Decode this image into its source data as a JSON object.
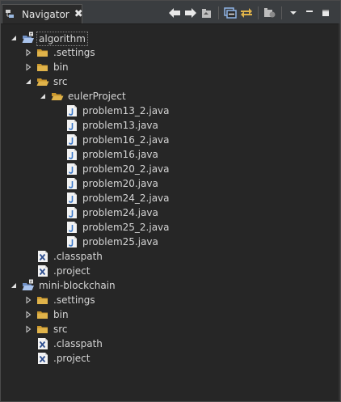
{
  "view": {
    "title": "Navigator",
    "close_symbol": "✖",
    "icon": "navigator-icon"
  },
  "toolbar": {
    "buttons": [
      {
        "name": "back-button",
        "icon": "arrow-left-icon"
      },
      {
        "name": "forward-button",
        "icon": "arrow-right-icon"
      },
      {
        "name": "up-button",
        "icon": "go-up-icon"
      },
      {
        "name": "collapse-all-button",
        "icon": "collapse-all-icon"
      },
      {
        "name": "link-with-editor-button",
        "icon": "link-icon"
      },
      {
        "name": "filters-button",
        "icon": "filter-icon"
      },
      {
        "name": "view-menu-button",
        "icon": "chevron-down-icon"
      },
      {
        "name": "minimize-button",
        "icon": "minimize-icon"
      },
      {
        "name": "maximize-button",
        "icon": "maximize-icon"
      }
    ]
  },
  "tree": [
    {
      "label": "algorithm",
      "type": "project",
      "depth": 0,
      "state": "expanded",
      "selected": true
    },
    {
      "label": ".settings",
      "type": "folder",
      "depth": 1,
      "state": "collapsed"
    },
    {
      "label": "bin",
      "type": "folder",
      "depth": 1,
      "state": "collapsed"
    },
    {
      "label": "src",
      "type": "folder-open",
      "depth": 1,
      "state": "expanded"
    },
    {
      "label": "eulerProject",
      "type": "folder-open",
      "depth": 2,
      "state": "expanded"
    },
    {
      "label": "problem13_2.java",
      "type": "java",
      "depth": 3,
      "state": "leaf"
    },
    {
      "label": "problem13.java",
      "type": "java",
      "depth": 3,
      "state": "leaf"
    },
    {
      "label": "problem16_2.java",
      "type": "java",
      "depth": 3,
      "state": "leaf"
    },
    {
      "label": "problem16.java",
      "type": "java",
      "depth": 3,
      "state": "leaf"
    },
    {
      "label": "problem20_2.java",
      "type": "java",
      "depth": 3,
      "state": "leaf"
    },
    {
      "label": "problem20.java",
      "type": "java",
      "depth": 3,
      "state": "leaf"
    },
    {
      "label": "problem24_2.java",
      "type": "java",
      "depth": 3,
      "state": "leaf"
    },
    {
      "label": "problem24.java",
      "type": "java",
      "depth": 3,
      "state": "leaf"
    },
    {
      "label": "problem25_2.java",
      "type": "java",
      "depth": 3,
      "state": "leaf"
    },
    {
      "label": "problem25.java",
      "type": "java",
      "depth": 3,
      "state": "leaf"
    },
    {
      "label": ".classpath",
      "type": "xml",
      "depth": 1,
      "state": "leaf"
    },
    {
      "label": ".project",
      "type": "xml",
      "depth": 1,
      "state": "leaf"
    },
    {
      "label": "mini-blockchain",
      "type": "project",
      "depth": 0,
      "state": "expanded"
    },
    {
      "label": ".settings",
      "type": "folder",
      "depth": 1,
      "state": "collapsed"
    },
    {
      "label": "bin",
      "type": "folder",
      "depth": 1,
      "state": "collapsed"
    },
    {
      "label": "src",
      "type": "folder",
      "depth": 1,
      "state": "collapsed"
    },
    {
      "label": ".classpath",
      "type": "xml",
      "depth": 1,
      "state": "leaf"
    },
    {
      "label": ".project",
      "type": "xml",
      "depth": 1,
      "state": "leaf"
    }
  ],
  "colors": {
    "background": "#262626",
    "text": "#d4d4d4",
    "folder": "#e0b34a",
    "java": "#3c78c8",
    "accent": "#4a90d9"
  }
}
